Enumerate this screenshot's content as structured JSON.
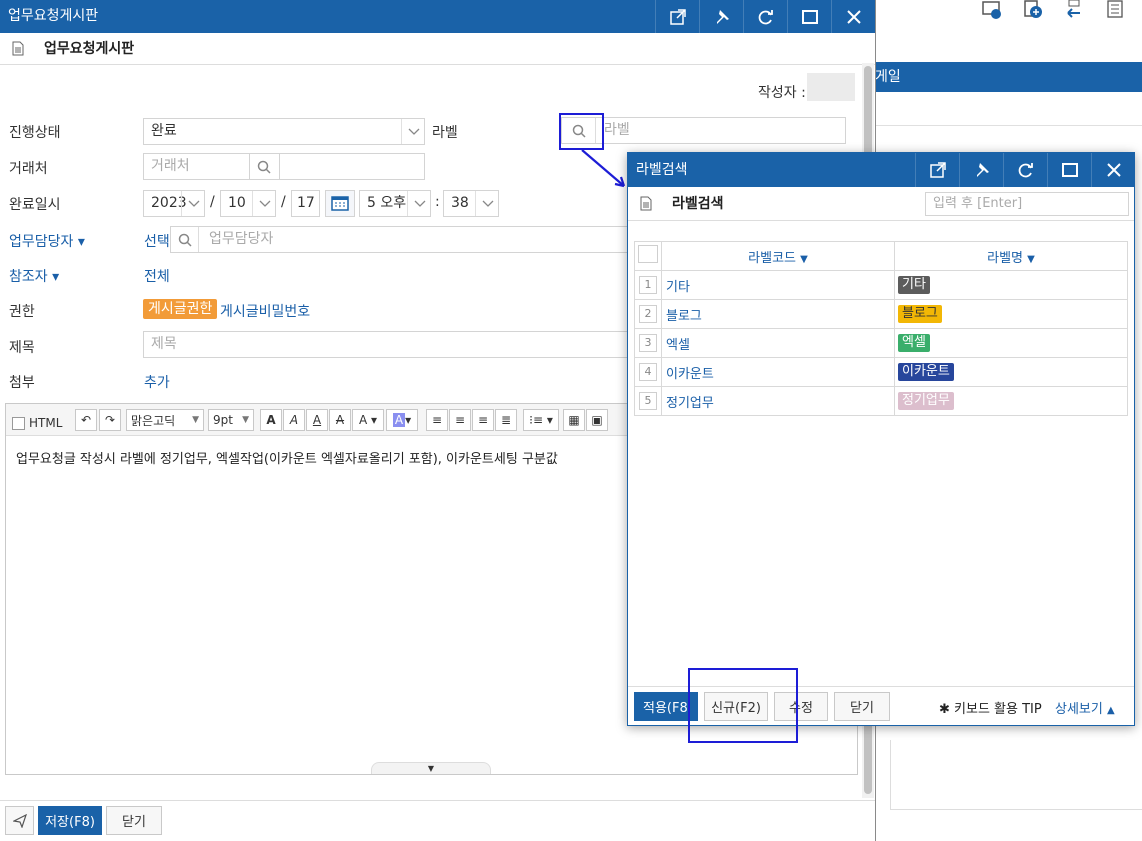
{
  "main": {
    "title": "업무요청게시판",
    "subtitle": "업무요청게시판",
    "author_label": "작성자 :",
    "fields": {
      "status": {
        "label": "진행상태",
        "value": "완료"
      },
      "label": {
        "label": "라벨",
        "placeholder": "라벨"
      },
      "client": {
        "label": "거래처",
        "placeholder": "거래처"
      },
      "done_date": {
        "label": "완료일시",
        "year": "2023",
        "month": "10",
        "day": "17",
        "hour": "5 오후",
        "minute": "38"
      },
      "assignee": {
        "label": "업무담당자",
        "select": "선택",
        "placeholder": "업무담당자"
      },
      "participants": {
        "label": "참조자",
        "value": "전체"
      },
      "permission": {
        "label": "권한",
        "tag": "게시글권한",
        "link": "게시글비밀번호"
      },
      "subject": {
        "label": "제목",
        "placeholder": "제목"
      },
      "attach": {
        "label": "첨부",
        "link": "추가"
      }
    },
    "editor": {
      "html_label": "HTML",
      "font": "맑은고딕",
      "size": "9pt",
      "body": "업무요청글 작성시 라벨에 정기업무, 엑셀작업(이카운트 엑셀자료올리기 포함), 이카운트세팅  구분값"
    },
    "buttons": {
      "save": "저장(F8)",
      "close": "닫기"
    }
  },
  "background": {
    "tab_text": "게일"
  },
  "popup": {
    "title": "라벨검색",
    "subtitle": "라벨검색",
    "search_placeholder": "입력 후 [Enter]",
    "columns": {
      "code": "라벨코드",
      "name": "라벨명"
    },
    "rows": [
      {
        "num": "1",
        "code": "기타",
        "name": "기타",
        "color": "#5c5c5c",
        "text_color": "#ffffff"
      },
      {
        "num": "2",
        "code": "블로그",
        "name": "블로그",
        "color": "#f2b705",
        "text_color": "#333333"
      },
      {
        "num": "3",
        "code": "엑셀",
        "name": "엑셀",
        "color": "#3aae6b",
        "text_color": "#ffffff"
      },
      {
        "num": "4",
        "code": "이카운트",
        "name": "이카운트",
        "color": "#27469c",
        "text_color": "#ffffff"
      },
      {
        "num": "5",
        "code": "정기업무",
        "name": "정기업무",
        "color": "#dcbecd",
        "text_color": "#ffffff"
      }
    ],
    "buttons": {
      "apply": "적용(F8",
      "new": "신규(F2)",
      "edit": "수정",
      "close": "닫기"
    },
    "tip_label": "키보드 활용 TIP",
    "tip_link": "상세보기"
  },
  "colors": {
    "brand": "#1a62a8",
    "highlight": "#1d1dd6",
    "perm_tag": "#f29b38"
  }
}
